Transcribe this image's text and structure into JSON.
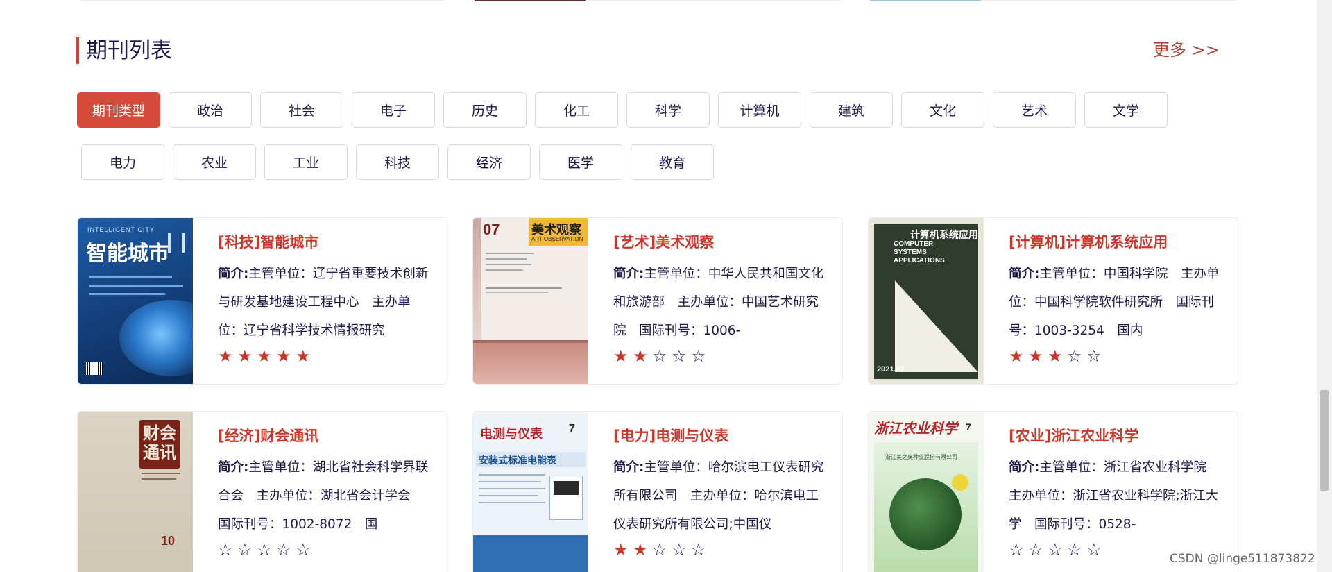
{
  "section": {
    "title": "期刊列表",
    "more_label": "更多 >>"
  },
  "categories_row1": [
    "期刊类型",
    "政治",
    "社会",
    "电子",
    "历史",
    "化工",
    "科学",
    "计算机",
    "建筑",
    "文化",
    "艺术",
    "文学"
  ],
  "categories_row2": [
    "电力",
    "农业",
    "工业",
    "科技",
    "经济",
    "医学",
    "教育"
  ],
  "intro_label": "简介:",
  "journals": [
    {
      "title": "[科技]智能城市",
      "intro": "主管单位：辽宁省重要技术创新与研发基地建设工程中心　主办单位：辽宁省科学技术情报研究",
      "rating": 5,
      "cover": {
        "bg": "#1d4f8f",
        "title_en": "INTELLIGENT CITY",
        "title_cn": "智能城市"
      }
    },
    {
      "title": "[艺术]美术观察",
      "intro": "主管单位：中华人民共和国文化和旅游部　主办单位：中国艺术研究院　国际刊号：1006-",
      "rating": 2,
      "cover": {
        "bg": "#f2ede8",
        "title_cn": "美术观察",
        "title_en": "ART OBSERVATION",
        "issue": "07"
      }
    },
    {
      "title": "[计算机]计算机系统应用",
      "intro": "主管单位：中国科学院　主办单位：中国科学院软件研究所　国际刊号：1003-3254　国内",
      "rating": 3,
      "cover": {
        "bg": "#2e3a2c",
        "title_cn": "计算机系统应用",
        "title_en": "COMPUTER SYSTEMS APPLICATIONS",
        "issue": "2021.07"
      }
    },
    {
      "title": "[经济]财会通讯",
      "intro": "主管单位：湖北省社会科学界联合会　主办单位：湖北省会计学会　国际刊号：1002-8072　国",
      "rating": 0,
      "cover": {
        "bg": "#d8cfbf",
        "title_cn": "财会通讯",
        "issue": "10"
      }
    },
    {
      "title": "[电力]电测与仪表",
      "intro": "主管单位：哈尔滨电工仪表研究所有限公司　主办单位：哈尔滨电工仪表研究所有限公司;中国仪",
      "rating": 2,
      "cover": {
        "bg": "#eef3f8",
        "title_cn": "电测与仪表",
        "banner": "安装式标准电能表",
        "issue": "7"
      }
    },
    {
      "title": "[农业]浙江农业科学",
      "intro": "主管单位：浙江省农业科学院　主办单位：浙江省农业科学院;浙江大学　国际刊号：0528-",
      "rating": 0,
      "cover": {
        "bg": "#f4f7f0",
        "title_cn": "浙江农业科学",
        "issue": "7",
        "company": "浙江美之奥种业股份有限公司"
      }
    }
  ],
  "watermark": "CSDN @linge511873822"
}
